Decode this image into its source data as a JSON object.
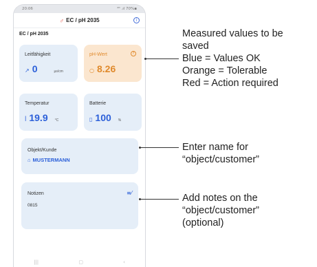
{
  "status_bar": {
    "time": "20:06",
    "right": "⁴ᴳ .ıl 70%▪"
  },
  "app": {
    "title": "EC / pH 2035",
    "logo_icon": "brand-logo-icon",
    "info_icon": "info-icon"
  },
  "section_label": "EC / pH 2035",
  "tiles": {
    "conductivity": {
      "label": "Leitfähigkeit",
      "icon": "↗",
      "value": "0",
      "unit": "µs/cm"
    },
    "ph": {
      "label": "pH-Wert",
      "icon": "○",
      "value": "8.26",
      "help": "?"
    },
    "temperature": {
      "label": "Temperatur",
      "icon": "ꟾ",
      "value": "19.9",
      "unit": "°C"
    },
    "battery": {
      "label": "Batterie",
      "icon": "▯",
      "value": "100",
      "unit": "%"
    }
  },
  "object": {
    "label": "Objekt/Kunde",
    "icon": "⌂",
    "value": "MUSTERMANN"
  },
  "notes": {
    "label": "Notizen",
    "value": "0815",
    "edit_icon": "≡⁄"
  },
  "nav": {
    "recent": "|||",
    "home": "▢",
    "back": "‹"
  },
  "annotations": {
    "values": "Measured values to be\nsaved\nBlue = Values OK\nOrange = Tolerable\nRed = Action required",
    "object": "Enter name for\n“object/customer”",
    "notes": "Add notes on the\n“object/customer”\n(optional)"
  },
  "colors": {
    "ok": "#2b5fd9",
    "tolerable": "#e08a2c",
    "tile_bg": "#e5eef8",
    "warn_bg": "#fbe6cf"
  }
}
